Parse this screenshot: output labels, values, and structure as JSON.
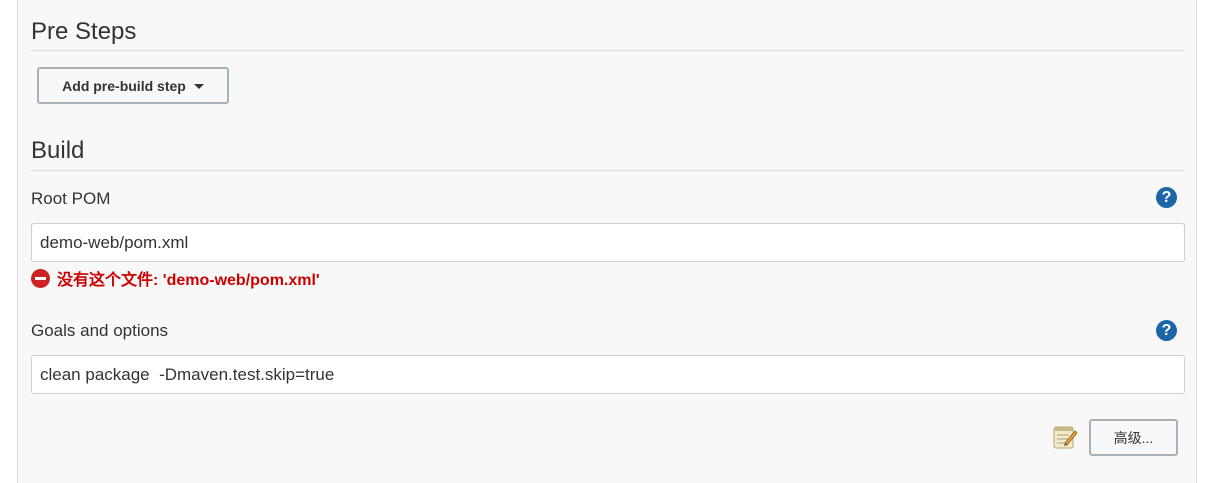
{
  "pre_steps": {
    "title": "Pre Steps",
    "add_button_label": "Add pre-build step"
  },
  "build": {
    "title": "Build",
    "root_pom": {
      "label": "Root POM",
      "value": "demo-web/pom.xml",
      "error": "没有这个文件: 'demo-web/pom.xml'"
    },
    "goals": {
      "label": "Goals and options",
      "value": "clean package  -Dmaven.test.skip=true"
    },
    "help_glyph": "?",
    "advanced_button_label": "高级..."
  },
  "icons": {
    "help": "help-icon",
    "error": "error-icon",
    "dropdown": "caret-down-icon",
    "notepad": "notepad-icon"
  },
  "colors": {
    "panel_bg": "#f8f8f8",
    "help_blue": "#1c66a6",
    "error_red": "#cc0000",
    "button_border": "#a9b1b8"
  }
}
